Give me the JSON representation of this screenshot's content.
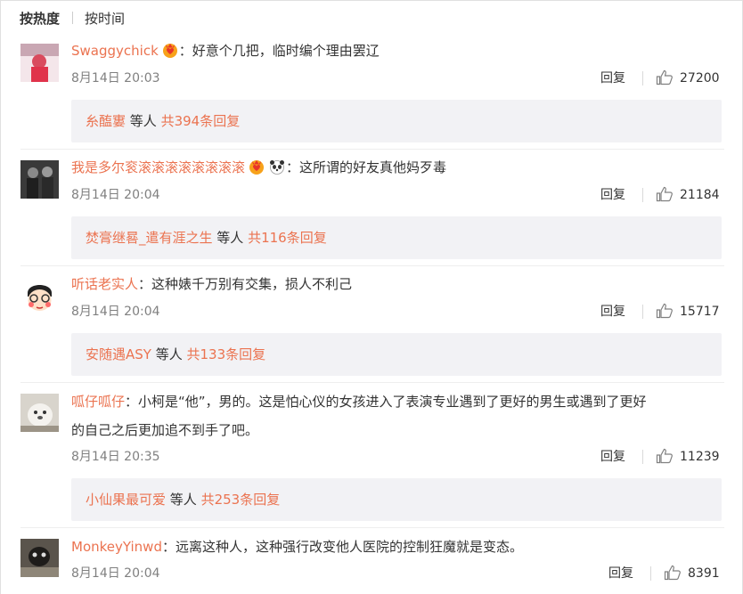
{
  "sort": {
    "hot": "按热度",
    "time": "按时间"
  },
  "comments": [
    {
      "user": "Swaggychick",
      "text": "：好意个几把，临时编个理由罢辽",
      "time": "8月14日 20:03",
      "reply": "回复",
      "likes": "27200",
      "sub_name": "糸醢寠",
      "sub_mid": " 等人 ",
      "sub_total": "共394条回复"
    },
    {
      "user": "我是多尔衮滚滚滚滚滚滚滚滚",
      "text": "：这所谓的好友真他妈歹毒",
      "time": "8月14日 20:04",
      "reply": "回复",
      "likes": "21184",
      "sub_name": "焚膏继晷_遣有涯之生",
      "sub_mid": " 等人 ",
      "sub_total": "共116条回复"
    },
    {
      "user": "听话老实人",
      "text": "：这种婊千万别有交集，损人不利己",
      "time": "8月14日 20:04",
      "reply": "回复",
      "likes": "15717",
      "sub_name": "安随遇ASY",
      "sub_mid": " 等人 ",
      "sub_total": "共133条回复"
    },
    {
      "user": "呱仔呱仔",
      "text": "：小柯是“他”，男的。这是怕心仪的女孩进入了表演专业遇到了更好的男生或遇到了更好",
      "text2": "的自己之后更加追不到手了吧。",
      "time": "8月14日 20:35",
      "reply": "回复",
      "likes": "11239",
      "sub_name": "小仙果最可爱",
      "sub_mid": " 等人 ",
      "sub_total": "共253条回复"
    },
    {
      "user": "MonkeyYinwd",
      "text": "：远离这种人，这种强行改变他人医院的控制狂魔就是变态。",
      "time": "8月14日 20:04",
      "reply": "回复",
      "likes": "8391"
    }
  ],
  "colors": {
    "username": "#eb7350",
    "muted": "#808080",
    "sub_bg": "#f2f2f5"
  },
  "icons": {
    "like": "thumbs-up-icon",
    "badge": "crown-heart-badge-icon",
    "emoji": "panda-emoji-icon"
  }
}
